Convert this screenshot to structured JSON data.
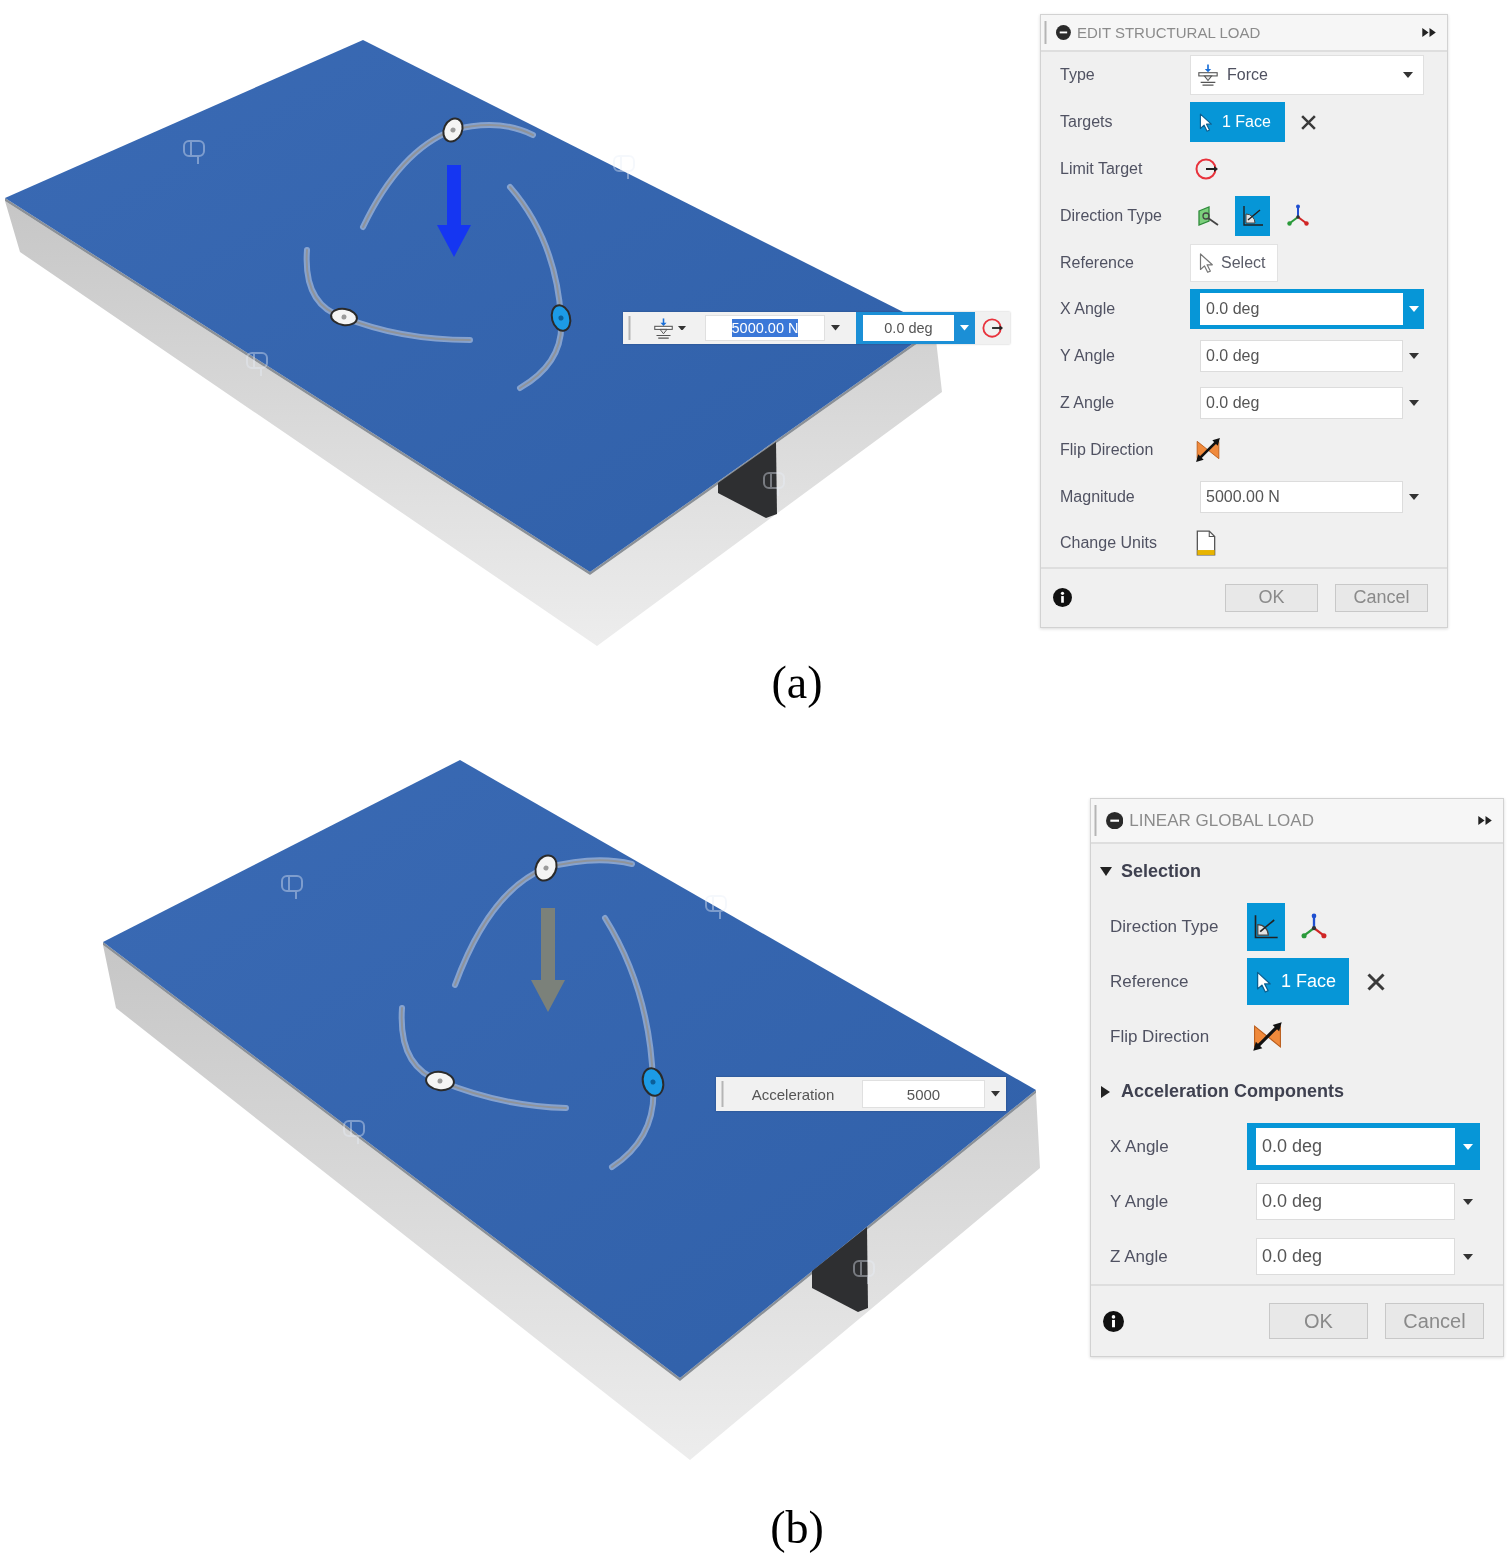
{
  "panels": [
    {
      "caption": "(a)",
      "viewport": {
        "load_arrow": {
          "highlighted": true
        },
        "toolbar": [
          {
            "kind": "type_menu"
          },
          {
            "kind": "field",
            "value": "5000.00 N",
            "text_selected": true,
            "focused": false
          },
          {
            "kind": "field",
            "value": "0.0 deg",
            "text_selected": false,
            "focused": true
          },
          {
            "kind": "limit"
          }
        ]
      },
      "dialog": {
        "title": "EDIT STRUCTURAL LOAD",
        "rows": [
          {
            "kind": "type_dropdown",
            "label": "Type",
            "value": "Force"
          },
          {
            "kind": "selection",
            "label": "Targets",
            "value": "1 Face"
          },
          {
            "kind": "limit",
            "label": "Limit Target"
          },
          {
            "kind": "direction",
            "label": "Direction Type",
            "options": [
              {
                "kind": "face",
                "selected": false
              },
              {
                "kind": "angles",
                "selected": true
              },
              {
                "kind": "axes",
                "selected": false
              }
            ]
          },
          {
            "kind": "select_button",
            "label": "Reference",
            "value": "Select"
          },
          {
            "kind": "field",
            "label": "X Angle",
            "value": "0.0 deg",
            "focused": true
          },
          {
            "kind": "field",
            "label": "Y Angle",
            "value": "0.0 deg",
            "focused": false
          },
          {
            "kind": "field",
            "label": "Z Angle",
            "value": "0.0 deg",
            "focused": false
          },
          {
            "kind": "flip",
            "label": "Flip Direction"
          },
          {
            "kind": "field",
            "label": "Magnitude",
            "value": "5000.00 N",
            "focused": false
          },
          {
            "kind": "units",
            "label": "Change Units"
          }
        ],
        "buttons": [
          "OK",
          "Cancel"
        ]
      }
    },
    {
      "caption": "(b)",
      "viewport": {
        "load_arrow": {
          "highlighted": false
        },
        "toolbar": [
          {
            "kind": "label",
            "text": "Acceleration"
          },
          {
            "kind": "field",
            "value": "5000",
            "text_selected": false,
            "focused": false
          }
        ]
      },
      "dialog": {
        "title": "LINEAR GLOBAL LOAD",
        "rows": [
          {
            "kind": "section",
            "label": "Selection",
            "expanded": true
          },
          {
            "kind": "direction",
            "label": "Direction Type",
            "options": [
              {
                "kind": "angles",
                "selected": true
              },
              {
                "kind": "axes",
                "selected": false
              }
            ]
          },
          {
            "kind": "selection",
            "label": "Reference",
            "value": "1 Face"
          },
          {
            "kind": "flip",
            "label": "Flip Direction"
          },
          {
            "kind": "section",
            "label": "Acceleration Components",
            "expanded": false
          },
          {
            "kind": "field",
            "label": "X Angle",
            "value": "0.0 deg",
            "focused": true
          },
          {
            "kind": "field",
            "label": "Y Angle",
            "value": "0.0 deg",
            "focused": false
          },
          {
            "kind": "field",
            "label": "Z Angle",
            "value": "0.0 deg",
            "focused": false
          }
        ],
        "buttons": [
          "OK",
          "Cancel"
        ]
      }
    }
  ]
}
